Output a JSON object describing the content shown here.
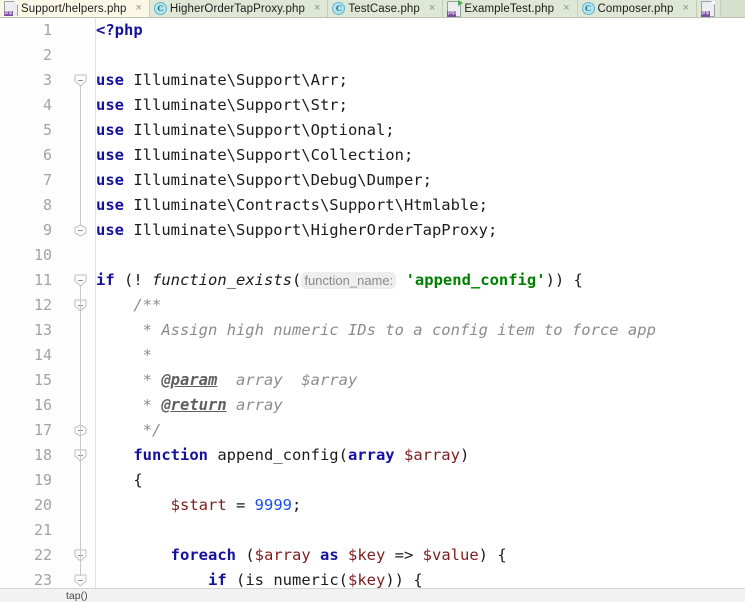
{
  "window": {
    "accent_keyword": "#14129c",
    "accent_string": "#008000",
    "accent_variable": "#7d1d1d",
    "accent_number": "#1750eb",
    "accent_comment": "#8c8c8c",
    "tab_active_bg": "#fbf8e8",
    "tab_bg": "#dfe7d6",
    "editor_bg": "#ffffff"
  },
  "tabs": [
    {
      "label": "Support/helpers.php",
      "icon": "php-file-icon",
      "active": true,
      "close": "×"
    },
    {
      "label": "HigherOrderTapProxy.php",
      "icon": "php-class-icon",
      "active": false,
      "close": "×"
    },
    {
      "label": "TestCase.php",
      "icon": "php-class-icon",
      "active": false,
      "close": "×"
    },
    {
      "label": "ExampleTest.php",
      "icon": "php-test-file-icon",
      "active": false,
      "close": "×"
    },
    {
      "label": "Composer.php",
      "icon": "php-class-icon",
      "active": false,
      "close": "×"
    }
  ],
  "breadcrumb": {
    "text": "tap()"
  },
  "editor": {
    "lines": [
      {
        "no": "1",
        "fold": "none",
        "tokens": [
          {
            "t": "<?php",
            "c": "kw"
          }
        ]
      },
      {
        "no": "2",
        "fold": "none",
        "tokens": []
      },
      {
        "no": "3",
        "fold": "start",
        "tokens": [
          {
            "t": "use",
            "c": "kw"
          },
          {
            "t": " Illuminate\\Support\\Arr;",
            "c": "fn"
          }
        ]
      },
      {
        "no": "4",
        "fold": "line",
        "tokens": [
          {
            "t": "use",
            "c": "kw"
          },
          {
            "t": " Illuminate\\Support\\Str;",
            "c": "fn"
          }
        ]
      },
      {
        "no": "5",
        "fold": "line",
        "tokens": [
          {
            "t": "use",
            "c": "kw"
          },
          {
            "t": " Illuminate\\Support\\Optional;",
            "c": "fn"
          }
        ]
      },
      {
        "no": "6",
        "fold": "line",
        "tokens": [
          {
            "t": "use",
            "c": "kw"
          },
          {
            "t": " Illuminate\\Support\\Collection;",
            "c": "fn"
          }
        ]
      },
      {
        "no": "7",
        "fold": "line",
        "tokens": [
          {
            "t": "use",
            "c": "kw"
          },
          {
            "t": " Illuminate\\Support\\Debug\\Dumper;",
            "c": "fn"
          }
        ]
      },
      {
        "no": "8",
        "fold": "line",
        "tokens": [
          {
            "t": "use",
            "c": "kw"
          },
          {
            "t": " Illuminate\\Contracts\\Support\\Htmlable;",
            "c": "fn"
          }
        ]
      },
      {
        "no": "9",
        "fold": "end",
        "tokens": [
          {
            "t": "use",
            "c": "kw"
          },
          {
            "t": " Illuminate\\Support\\HigherOrderTapProxy;",
            "c": "fn"
          }
        ]
      },
      {
        "no": "10",
        "fold": "none",
        "tokens": []
      },
      {
        "no": "11",
        "fold": "start",
        "tokens": [
          {
            "t": "if",
            "c": "kw"
          },
          {
            "t": " (! ",
            "c": "punc"
          },
          {
            "t": "function_exists",
            "c": "fnit"
          },
          {
            "t": "(",
            "c": "punc"
          },
          {
            "t": "function_name:",
            "c": "hint"
          },
          {
            "t": " ",
            "c": "punc"
          },
          {
            "t": "'append_config'",
            "c": "str"
          },
          {
            "t": ")) {",
            "c": "punc"
          }
        ]
      },
      {
        "no": "12",
        "fold": "start2",
        "tokens": [
          {
            "t": "    /**",
            "c": "cmt"
          }
        ]
      },
      {
        "no": "13",
        "fold": "line2",
        "tokens": [
          {
            "t": "     * Assign high numeric IDs to a config item to force app",
            "c": "cmt"
          }
        ]
      },
      {
        "no": "14",
        "fold": "line2",
        "tokens": [
          {
            "t": "     *",
            "c": "cmt"
          }
        ]
      },
      {
        "no": "15",
        "fold": "line2",
        "tokens": [
          {
            "t": "     * ",
            "c": "cmt"
          },
          {
            "t": "@param",
            "c": "tag"
          },
          {
            "t": "  array  $array",
            "c": "cmt"
          }
        ]
      },
      {
        "no": "16",
        "fold": "line2",
        "tokens": [
          {
            "t": "     * ",
            "c": "cmt"
          },
          {
            "t": "@return",
            "c": "tag"
          },
          {
            "t": " array",
            "c": "cmt"
          }
        ]
      },
      {
        "no": "17",
        "fold": "end2",
        "tokens": [
          {
            "t": "     */",
            "c": "cmt"
          }
        ]
      },
      {
        "no": "18",
        "fold": "start2",
        "tokens": [
          {
            "t": "    ",
            "c": "punc"
          },
          {
            "t": "function",
            "c": "kw"
          },
          {
            "t": " append_config(",
            "c": "fn"
          },
          {
            "t": "array",
            "c": "kw"
          },
          {
            "t": " ",
            "c": "fn"
          },
          {
            "t": "$array",
            "c": "var"
          },
          {
            "t": ")",
            "c": "punc"
          }
        ]
      },
      {
        "no": "19",
        "fold": "line2",
        "tokens": [
          {
            "t": "    {",
            "c": "punc"
          }
        ]
      },
      {
        "no": "20",
        "fold": "line2",
        "tokens": [
          {
            "t": "        ",
            "c": "punc"
          },
          {
            "t": "$start",
            "c": "var"
          },
          {
            "t": " = ",
            "c": "punc"
          },
          {
            "t": "9999",
            "c": "num"
          },
          {
            "t": ";",
            "c": "punc"
          }
        ]
      },
      {
        "no": "21",
        "fold": "line2",
        "tokens": []
      },
      {
        "no": "22",
        "fold": "start3",
        "tokens": [
          {
            "t": "        ",
            "c": "punc"
          },
          {
            "t": "foreach",
            "c": "kw"
          },
          {
            "t": " (",
            "c": "punc"
          },
          {
            "t": "$array",
            "c": "var"
          },
          {
            "t": " ",
            "c": "punc"
          },
          {
            "t": "as",
            "c": "kw"
          },
          {
            "t": " ",
            "c": "punc"
          },
          {
            "t": "$key",
            "c": "var"
          },
          {
            "t": " => ",
            "c": "punc"
          },
          {
            "t": "$value",
            "c": "var"
          },
          {
            "t": ") {",
            "c": "punc"
          }
        ]
      },
      {
        "no": "23",
        "fold": "start4",
        "tokens": [
          {
            "t": "            ",
            "c": "punc"
          },
          {
            "t": "if",
            "c": "kw"
          },
          {
            "t": " (",
            "c": "punc"
          },
          {
            "t": "is_numeric",
            "c": "fn"
          },
          {
            "t": "(",
            "c": "punc"
          },
          {
            "t": "$key",
            "c": "var"
          },
          {
            "t": ")) {",
            "c": "punc"
          }
        ]
      }
    ]
  }
}
